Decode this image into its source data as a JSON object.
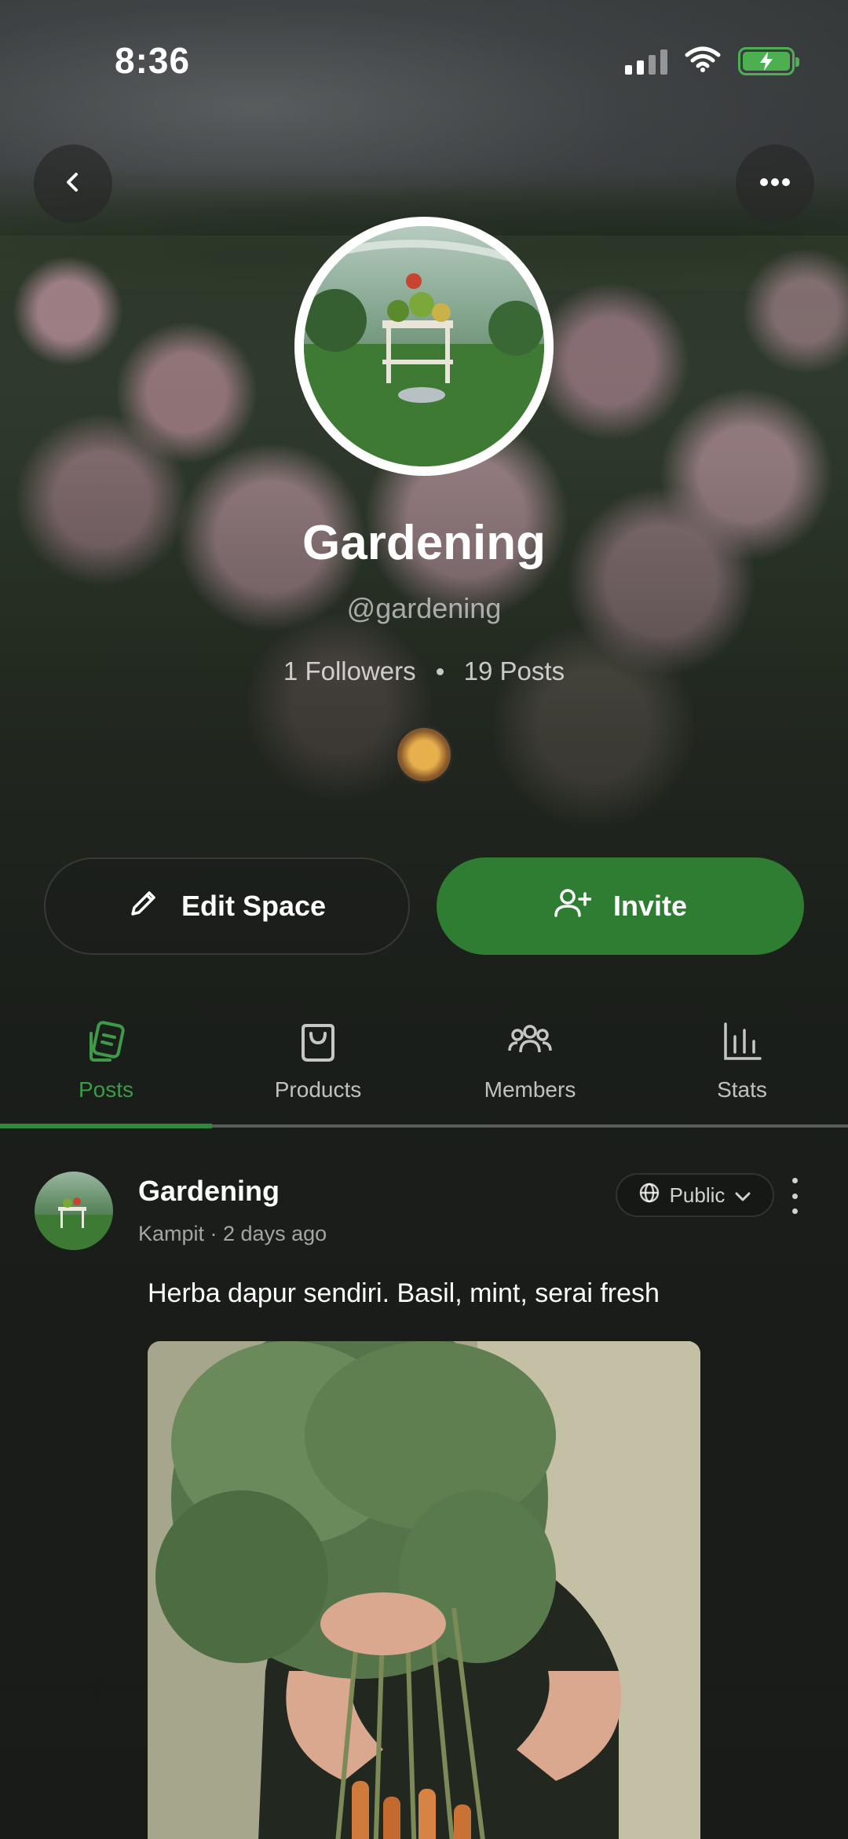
{
  "status_bar": {
    "time": "8:36"
  },
  "profile": {
    "name": "Gardening",
    "handle": "@gardening",
    "followers": "1 Followers",
    "posts": "19 Posts"
  },
  "actions": {
    "edit_label": "Edit Space",
    "invite_label": "Invite"
  },
  "tabs": [
    {
      "label": "Posts",
      "icon": "posts-icon",
      "active": true
    },
    {
      "label": "Products",
      "icon": "shopping-bag-icon",
      "active": false
    },
    {
      "label": "Members",
      "icon": "members-icon",
      "active": false
    },
    {
      "label": "Stats",
      "icon": "stats-icon",
      "active": false
    }
  ],
  "post": {
    "author": "Gardening",
    "meta": "Kampit · 2 days ago",
    "visibility": "Public",
    "text": "Herba dapur sendiri. Basil, mint, serai fresh"
  },
  "colors": {
    "accent": "#2e7d32",
    "active_tab": "#3e9a48"
  }
}
